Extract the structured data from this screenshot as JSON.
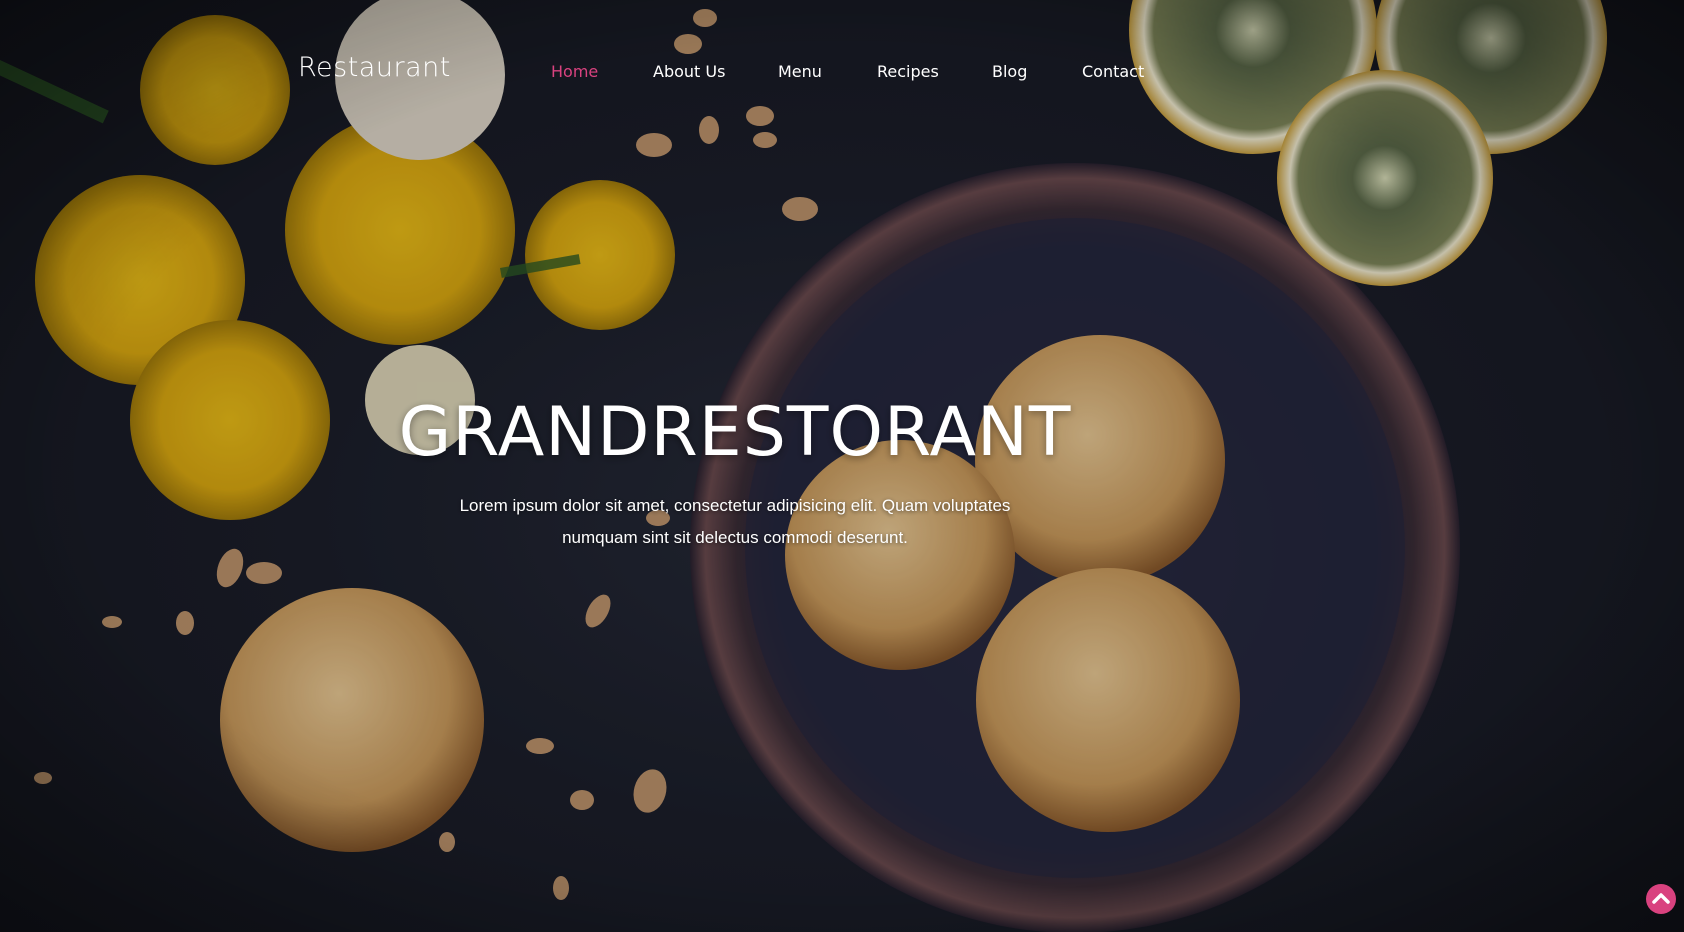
{
  "brand": {
    "name": "Restaurant"
  },
  "nav": {
    "items": [
      {
        "label": "Home",
        "active": true
      },
      {
        "label": "About Us",
        "active": false
      },
      {
        "label": "Menu",
        "active": false
      },
      {
        "label": "Recipes",
        "active": false
      },
      {
        "label": "Blog",
        "active": false
      },
      {
        "label": "Contact",
        "active": false
      }
    ]
  },
  "hero": {
    "title": "GRANDRESTORANT",
    "subtitle_line1": "Lorem ipsum dolor sit amet, consectetur adipisicing elit. Quam voluptates",
    "subtitle_line2": "numquam sint sit delectus commodi deserunt."
  },
  "scroll_top": {
    "icon": "chevron-up-icon"
  },
  "colors": {
    "accent": "#d9427f",
    "text": "#ffffff",
    "background": "#1a1d27"
  }
}
